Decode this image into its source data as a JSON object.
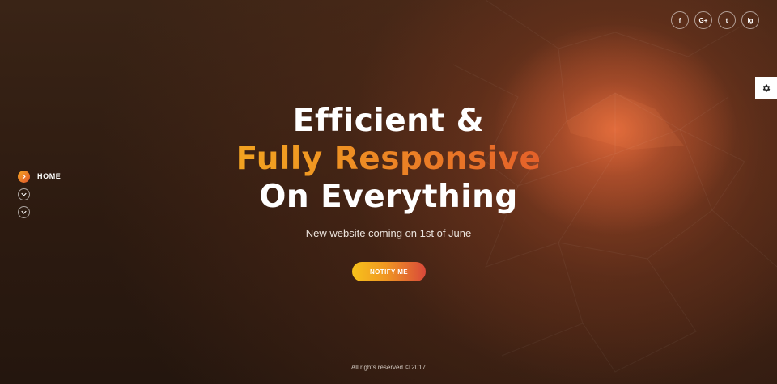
{
  "header": {
    "social_links": [
      {
        "icon": "facebook-icon",
        "glyph": "f"
      },
      {
        "icon": "google-plus-icon",
        "glyph": "G+"
      },
      {
        "icon": "twitter-icon",
        "glyph": "t"
      },
      {
        "icon": "instagram-icon",
        "glyph": "ig"
      }
    ]
  },
  "settings_panel": {
    "icon": "gear-icon"
  },
  "side_nav": {
    "items": [
      {
        "label": "HOME",
        "active": true,
        "icon": "chevron-right-icon"
      },
      {
        "label": "",
        "active": false,
        "icon": "chevron-down-icon"
      },
      {
        "label": "",
        "active": false,
        "icon": "chevron-down-icon"
      }
    ]
  },
  "hero": {
    "line1": "Efficient &",
    "line2": "Fully Responsive",
    "line3": "On Everything",
    "subtitle": "New website coming on 1st of June",
    "cta_label": "NOTIFY ME"
  },
  "footer": {
    "copyright": "All rights reserved © 2017"
  },
  "colors": {
    "background": "#2e1a10",
    "accent_yellow": "#f7c51c",
    "accent_orange": "#f09822",
    "accent_red": "#e2562b"
  }
}
